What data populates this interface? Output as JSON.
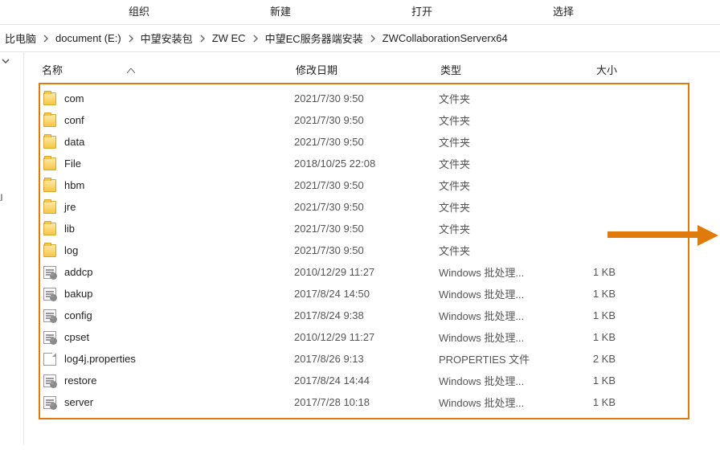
{
  "ribbon": {
    "group1": "组织",
    "group2": "新建",
    "group3": "打开",
    "group4": "选择"
  },
  "breadcrumb": [
    {
      "label": "比电脑"
    },
    {
      "label": "document (E:)"
    },
    {
      "label": "中望安装包"
    },
    {
      "label": "ZW EC"
    },
    {
      "label": "中望EC服务器端安装"
    },
    {
      "label": "ZWCollaborationServerx64"
    }
  ],
  "columns": {
    "name": "名称",
    "date": "修改日期",
    "type": "类型",
    "size": "大小"
  },
  "rows": [
    {
      "icon": "folder",
      "name": "com",
      "date": "2021/7/30 9:50",
      "type": "文件夹",
      "size": ""
    },
    {
      "icon": "folder",
      "name": "conf",
      "date": "2021/7/30 9:50",
      "type": "文件夹",
      "size": ""
    },
    {
      "icon": "folder",
      "name": "data",
      "date": "2021/7/30 9:50",
      "type": "文件夹",
      "size": ""
    },
    {
      "icon": "folder",
      "name": "File",
      "date": "2018/10/25 22:08",
      "type": "文件夹",
      "size": ""
    },
    {
      "icon": "folder",
      "name": "hbm",
      "date": "2021/7/30 9:50",
      "type": "文件夹",
      "size": ""
    },
    {
      "icon": "folder",
      "name": "jre",
      "date": "2021/7/30 9:50",
      "type": "文件夹",
      "size": ""
    },
    {
      "icon": "folder",
      "name": "lib",
      "date": "2021/7/30 9:50",
      "type": "文件夹",
      "size": ""
    },
    {
      "icon": "folder",
      "name": "log",
      "date": "2021/7/30 9:50",
      "type": "文件夹",
      "size": ""
    },
    {
      "icon": "bat",
      "name": "addcp",
      "date": "2010/12/29 11:27",
      "type": "Windows 批处理...",
      "size": "1 KB"
    },
    {
      "icon": "bat",
      "name": "bakup",
      "date": "2017/8/24 14:50",
      "type": "Windows 批处理...",
      "size": "1 KB"
    },
    {
      "icon": "bat",
      "name": "config",
      "date": "2017/8/24 9:38",
      "type": "Windows 批处理...",
      "size": "1 KB"
    },
    {
      "icon": "bat",
      "name": "cpset",
      "date": "2010/12/29 11:27",
      "type": "Windows 批处理...",
      "size": "1 KB"
    },
    {
      "icon": "file",
      "name": "log4j.properties",
      "date": "2017/8/26 9:13",
      "type": "PROPERTIES 文件",
      "size": "2 KB"
    },
    {
      "icon": "bat",
      "name": "restore",
      "date": "2017/8/24 14:44",
      "type": "Windows 批处理...",
      "size": "1 KB"
    },
    {
      "icon": "bat",
      "name": "server",
      "date": "2017/7/28 10:18",
      "type": "Windows 批处理...",
      "size": "1 KB"
    }
  ],
  "navstub": "al"
}
